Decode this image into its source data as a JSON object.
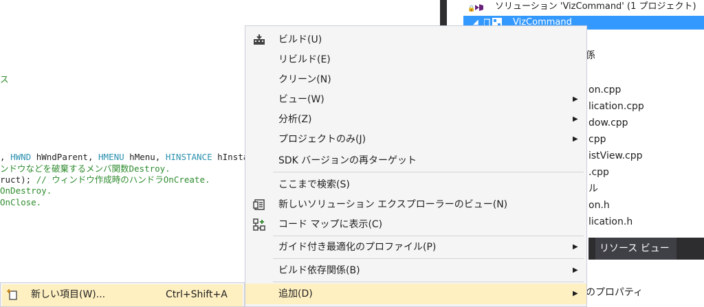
{
  "editor": {
    "frag_su": "ス",
    "line1_prefix": ", ",
    "line1_kw1": "HWND",
    "line1_p1": " hWndParent, ",
    "line1_kw2": "HMENU",
    "line1_p2": " hMenu, ",
    "line1_kw3": "HINSTANCE",
    "line1_p3": " hInsta",
    "line2": "ンドウなどを破棄するメンバ関数Destroy.",
    "line3_plain": "ruct); ",
    "line3_cmt": "// ウィンドウ作成時のハンドラOnCreate.",
    "line4": "OnDestroy.",
    "line5": "OnClose."
  },
  "solution_explorer": {
    "header": "ソリューション 'VizCommand' (1 プロジェクト)",
    "project": "VizCommand",
    "items": [
      "係",
      "on.cpp",
      "lication.cpp",
      "dow.cpp",
      "cpp",
      "istView.cpp",
      ".cpp",
      "ル",
      "on.h",
      "lication.h"
    ],
    "tab": "リソース ビュー",
    "properties": "のプロパティ"
  },
  "context_menu": {
    "items": [
      {
        "label": "ビルド(U)",
        "icon": "build-icon",
        "submenu": false
      },
      {
        "label": "リビルド(E)",
        "icon": "",
        "submenu": false
      },
      {
        "label": "クリーン(N)",
        "icon": "",
        "submenu": false
      },
      {
        "label": "ビュー(W)",
        "icon": "",
        "submenu": true
      },
      {
        "label": "分析(Z)",
        "icon": "",
        "submenu": true
      },
      {
        "label": "プロジェクトのみ(J)",
        "icon": "",
        "submenu": true
      },
      {
        "label": "SDK バージョンの再ターゲット",
        "icon": "",
        "submenu": false
      },
      {
        "label": "ここまで検索(S)",
        "icon": "",
        "submenu": false
      },
      {
        "label": "新しいソリューション エクスプローラーのビュー(N)",
        "icon": "new-view-icon",
        "submenu": false
      },
      {
        "label": "コード マップに表示(C)",
        "icon": "code-map-icon",
        "submenu": false
      },
      {
        "label": "ガイド付き最適化のプロファイル(P)",
        "icon": "",
        "submenu": true
      },
      {
        "label": "ビルド依存関係(B)",
        "icon": "",
        "submenu": true
      },
      {
        "label": "追加(D)",
        "icon": "",
        "submenu": true
      }
    ]
  },
  "add_submenu": {
    "label": "新しい項目(W)...",
    "shortcut": "Ctrl+Shift+A",
    "icon": "new-item-icon"
  },
  "colors": {
    "selection": "#3399ff",
    "highlight": "#fff0c2",
    "menu_bg": "#f5f5f5",
    "keyword": "#2b91af",
    "comment": "#2e8b2e"
  }
}
